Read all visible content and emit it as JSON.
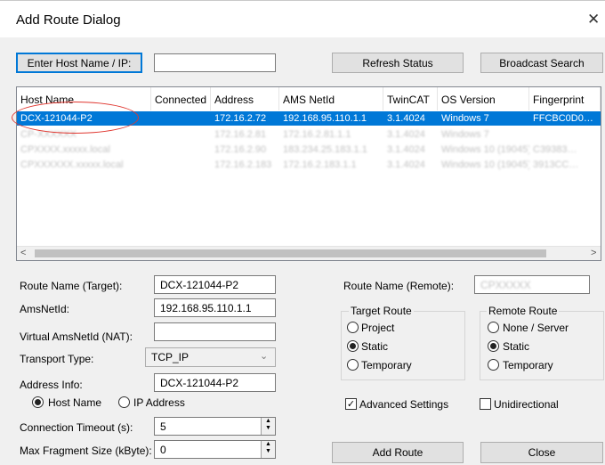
{
  "window": {
    "title": "Add Route Dialog",
    "close_glyph": "✕"
  },
  "toolbar": {
    "enter_host_label": "Enter Host Name / IP:",
    "host_input_value": "",
    "refresh_label": "Refresh Status",
    "broadcast_label": "Broadcast Search"
  },
  "list": {
    "columns": [
      "Host Name",
      "Connected",
      "Address",
      "AMS NetId",
      "TwinCAT",
      "OS Version",
      "Fingerprint"
    ],
    "rows": [
      {
        "host": "DCX-121044-P2",
        "connected": "",
        "address": "172.16.2.72",
        "netid": "192.168.95.110.1.1",
        "twincat": "3.1.4024",
        "os": "Windows 7",
        "fingerprint": "FFCBC0D0…",
        "selected": true
      },
      {
        "host": "CP-XXXXXX",
        "connected": "",
        "address": "172.16.2.81",
        "netid": "172.16.2.81.1.1",
        "twincat": "3.1.4024",
        "os": "Windows 7",
        "fingerprint": "",
        "selected": false
      },
      {
        "host": "CPXXXX.xxxxx.local",
        "connected": "",
        "address": "172.16.2.90",
        "netid": "183.234.25.183.1.1",
        "twincat": "3.1.4024",
        "os": "Windows 10 (19045)",
        "fingerprint": "C39383…",
        "selected": false
      },
      {
        "host": "CPXXXXXX.xxxxx.local",
        "connected": "",
        "address": "172.16.2.183",
        "netid": "172.16.2.183.1.1",
        "twincat": "3.1.4024",
        "os": "Windows 10 (19045)",
        "fingerprint": "3913CC…",
        "selected": false
      }
    ],
    "scroll_left": "<",
    "scroll_right": ">"
  },
  "form": {
    "route_name_label": "Route Name (Target):",
    "route_name_value": "DCX-121044-P2",
    "amsnetid_label": "AmsNetId:",
    "amsnetid_value": "192.168.95.110.1.1",
    "virtual_label": "Virtual AmsNetId (NAT):",
    "virtual_value": "",
    "transport_label": "Transport Type:",
    "transport_value": "TCP_IP",
    "address_info_label": "Address Info:",
    "address_info_value": "DCX-121044-P2",
    "host_name_radio": "Host Name",
    "ip_address_radio": "IP Address",
    "timeout_label": "Connection Timeout (s):",
    "timeout_value": "5",
    "fragment_label": "Max Fragment Size (kByte):",
    "fragment_value": "0"
  },
  "right": {
    "remote_name_label": "Route Name (Remote):",
    "remote_name_value": "CPXXXXX",
    "target_route_title": "Target Route",
    "target_options": [
      "Project",
      "Static",
      "Temporary"
    ],
    "target_selected": "Static",
    "remote_route_title": "Remote Route",
    "remote_options": [
      "None / Server",
      "Static",
      "Temporary"
    ],
    "remote_selected": "Static",
    "advanced_label": "Advanced Settings",
    "advanced_checked": true,
    "unidirectional_label": "Unidirectional",
    "unidirectional_checked": false,
    "add_route_label": "Add Route",
    "close_label": "Close"
  },
  "colors": {
    "selection": "#0078d7",
    "annotation": "#e0362f"
  }
}
